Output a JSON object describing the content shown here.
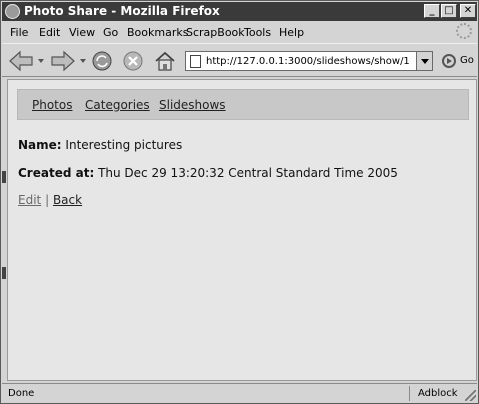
{
  "window": {
    "title": "Photo Share - Mozilla Firefox"
  },
  "menu": {
    "items": [
      "File",
      "Edit",
      "View",
      "Go",
      "Bookmarks",
      "ScrapBook",
      "Tools",
      "Help"
    ]
  },
  "toolbar": {
    "url": "http://127.0.0.1:3000/slideshows/show/1",
    "go_label": "Go"
  },
  "page": {
    "nav_links": [
      "Photos",
      "Categories",
      "Slideshows"
    ],
    "name_label": "Name:",
    "name_value": "Interesting pictures",
    "created_label": "Created at:",
    "created_value": "Thu Dec 29 13:20:32 Central Standard Time 2005",
    "edit_link": "Edit",
    "separator": "|",
    "back_link": "Back"
  },
  "status": {
    "text": "Done",
    "adblock": "Adblock"
  },
  "colors": {
    "title_bar": "#3a3a3a",
    "chrome": "#d4d4d4",
    "content_bg": "#e6e6e6",
    "nav_panel": "#c8c8c8"
  }
}
